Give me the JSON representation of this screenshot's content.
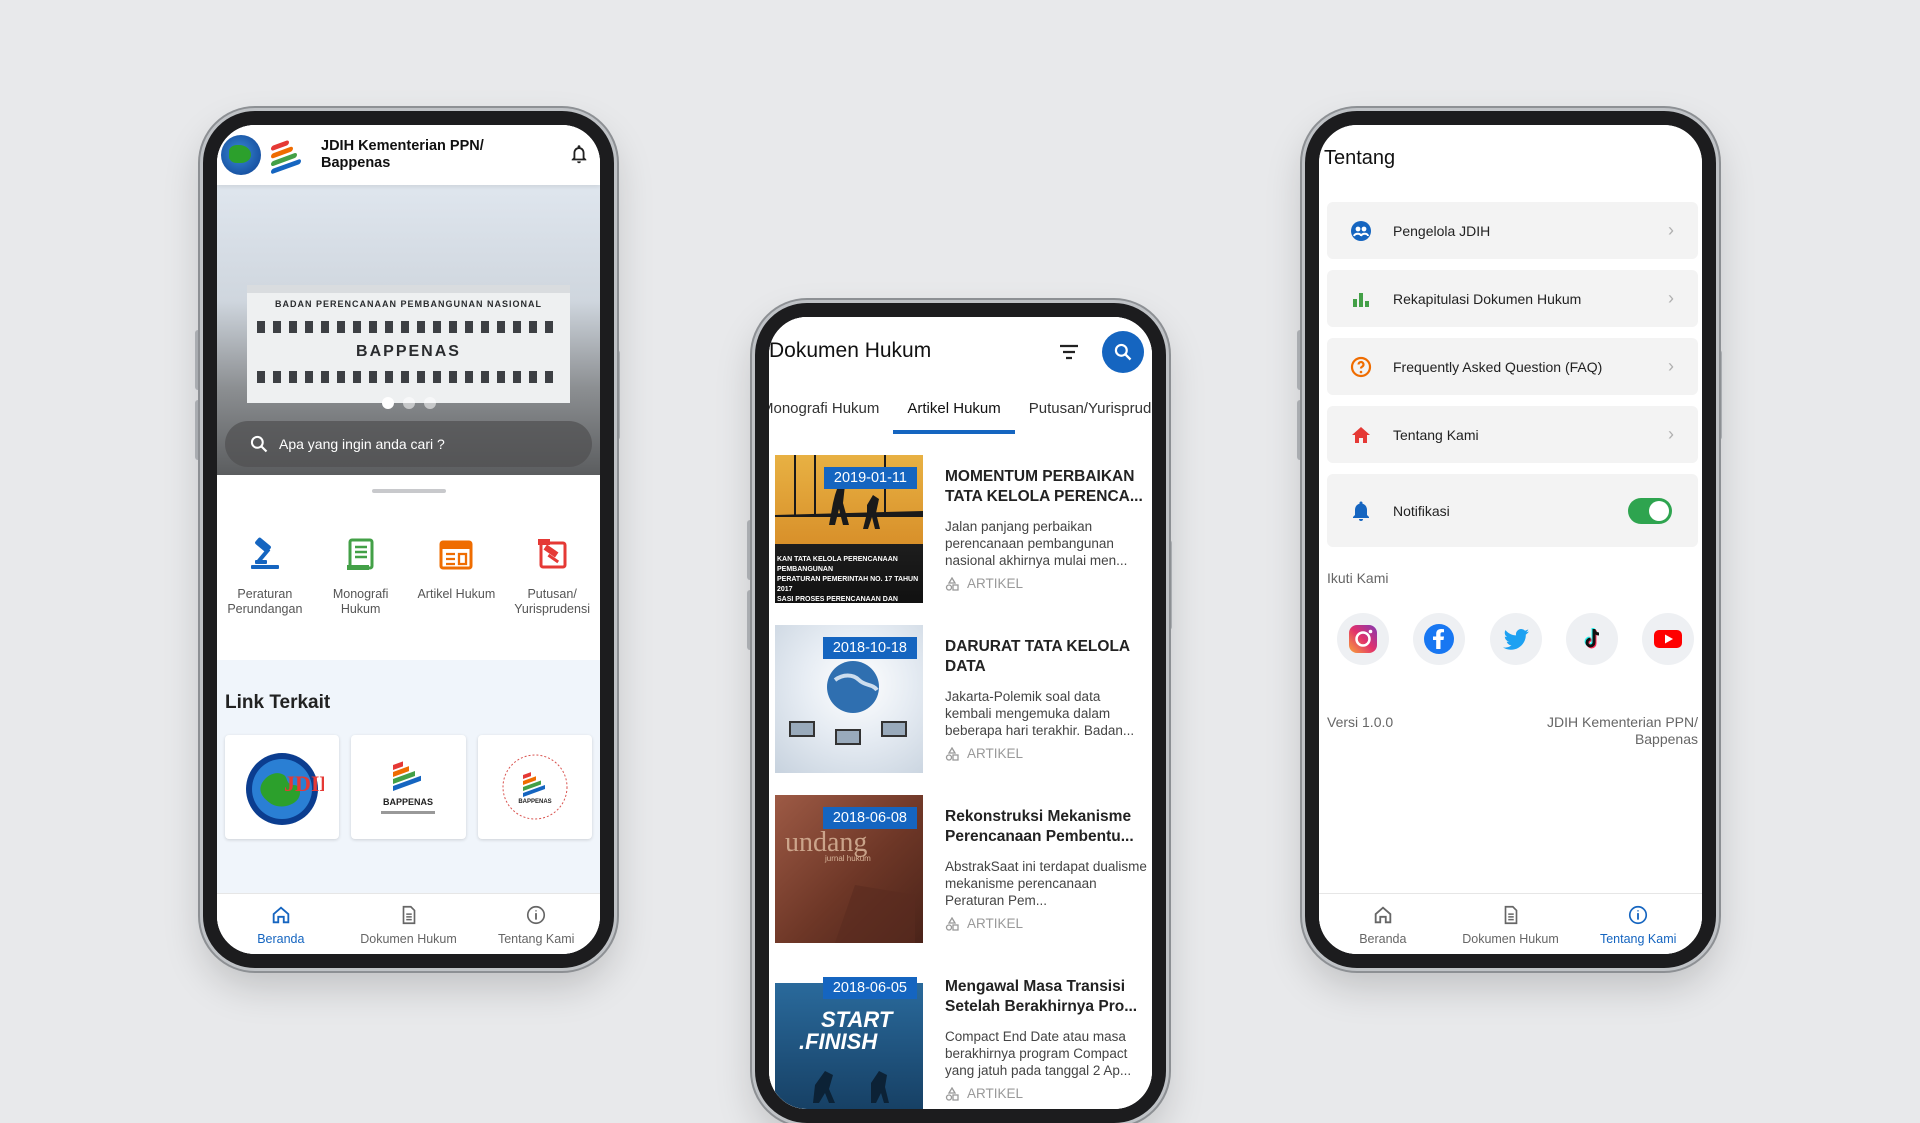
{
  "phone_home": {
    "app_title": "JDIH Kementerian PPN/ Bappenas",
    "hero": {
      "building_top_text": "BADAN PERENCANAAN PEMBANGUNAN NASIONAL",
      "building_name": "BAPPENAS",
      "slides_total": 3,
      "slide_active": 1
    },
    "search_placeholder": "Apa yang ingin anda cari ?",
    "categories": [
      {
        "label": "Peraturan Perundangan",
        "icon": "gavel-icon",
        "color": "#1565c0"
      },
      {
        "label": "Monografi Hukum",
        "icon": "book-icon",
        "color": "#43a047"
      },
      {
        "label": "Artikel Hukum",
        "icon": "newspaper-icon",
        "color": "#ef6c00"
      },
      {
        "label": "Putusan/ Yurisprudensi",
        "icon": "hammer-icon",
        "color": "#e53935"
      }
    ],
    "links_title": "Link Terkait",
    "links": [
      {
        "name": "JDIH",
        "icon": "jdih-logo"
      },
      {
        "name": "BAPPENAS",
        "icon": "bappenas-logo"
      },
      {
        "name": "JDIH Bappenas",
        "icon": "jdih-bappenas-logo"
      }
    ]
  },
  "phone_docs": {
    "title": "Dokumen Hukum",
    "tabs": [
      "Monografi Hukum",
      "Artikel Hukum",
      "Putusan/Yurisprudensi"
    ],
    "active_tab": "Artikel Hukum",
    "items": [
      {
        "date": "2019-01-11",
        "title": "MOMENTUM PERBAIKAN TATA KELOLA PERENCA...",
        "desc": "Jalan panjang perbaikan perencanaan pembangunan nasional akhirnya mulai men...",
        "tag": "ARTIKEL",
        "thumb_color": "#e3a533"
      },
      {
        "date": "2018-10-18",
        "title": "DARURAT TATA KELOLA DATA",
        "desc": "Jakarta-Polemik soal data kembali mengemuka dalam beberapa hari terakhir. Badan...",
        "tag": "ARTIKEL",
        "thumb_color": "#d8dee6"
      },
      {
        "date": "2018-06-08",
        "title": "Rekonstruksi Mekanisme Perencanaan Pembentu...",
        "desc": "AbstrakSaat ini terdapat dualisme mekanisme perencanaan Peraturan Pem...",
        "tag": "ARTIKEL",
        "thumb_color": "#8a4b3a"
      },
      {
        "date": "2018-06-05",
        "title": "Mengawal Masa Transisi Setelah Berakhirnya Pro...",
        "desc": "Compact End Date atau masa berakhirnya program Compact yang jatuh pada tanggal 2 Ap...",
        "tag": "ARTIKEL",
        "thumb_color": "#1f5b8a"
      }
    ]
  },
  "phone_about": {
    "title": "Tentang",
    "menu": [
      {
        "label": "Pengelola JDIH",
        "icon": "people-icon",
        "color": "#1565c0"
      },
      {
        "label": "Rekapitulasi Dokumen Hukum",
        "icon": "bar-chart-icon",
        "color": "#43a047"
      },
      {
        "label": "Frequently Asked Question (FAQ)",
        "icon": "help-icon",
        "color": "#ef6c00"
      },
      {
        "label": "Tentang Kami",
        "icon": "home-icon",
        "color": "#e53935"
      }
    ],
    "notif_label": "Notifikasi",
    "notif_on": true,
    "follow_label": "Ikuti Kami",
    "socials": [
      "instagram",
      "facebook",
      "twitter",
      "tiktok",
      "youtube"
    ],
    "version": "Versi 1.0.0",
    "org": "JDIH Kementerian PPN/ Bappenas"
  },
  "nav": {
    "items": [
      "Beranda",
      "Dokumen Hukum",
      "Tentang Kami"
    ]
  },
  "colors": {
    "primary": "#1565c0",
    "background": "#e8e9eb",
    "toggle_on": "#2ea44f"
  }
}
